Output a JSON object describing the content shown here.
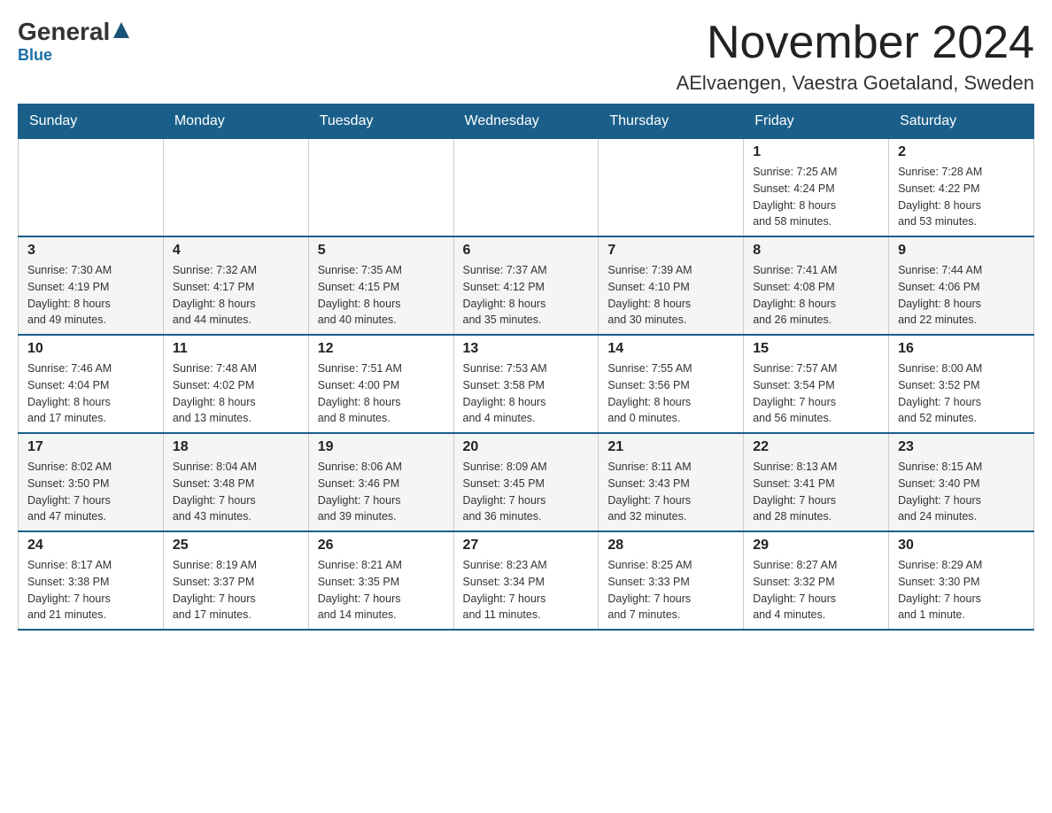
{
  "header": {
    "logo_general": "General",
    "logo_blue": "Blue",
    "month_title": "November 2024",
    "location": "AElvaengen, Vaestra Goetaland, Sweden"
  },
  "days_of_week": [
    "Sunday",
    "Monday",
    "Tuesday",
    "Wednesday",
    "Thursday",
    "Friday",
    "Saturday"
  ],
  "weeks": [
    {
      "days": [
        {
          "num": "",
          "info": ""
        },
        {
          "num": "",
          "info": ""
        },
        {
          "num": "",
          "info": ""
        },
        {
          "num": "",
          "info": ""
        },
        {
          "num": "",
          "info": ""
        },
        {
          "num": "1",
          "info": "Sunrise: 7:25 AM\nSunset: 4:24 PM\nDaylight: 8 hours\nand 58 minutes."
        },
        {
          "num": "2",
          "info": "Sunrise: 7:28 AM\nSunset: 4:22 PM\nDaylight: 8 hours\nand 53 minutes."
        }
      ]
    },
    {
      "days": [
        {
          "num": "3",
          "info": "Sunrise: 7:30 AM\nSunset: 4:19 PM\nDaylight: 8 hours\nand 49 minutes."
        },
        {
          "num": "4",
          "info": "Sunrise: 7:32 AM\nSunset: 4:17 PM\nDaylight: 8 hours\nand 44 minutes."
        },
        {
          "num": "5",
          "info": "Sunrise: 7:35 AM\nSunset: 4:15 PM\nDaylight: 8 hours\nand 40 minutes."
        },
        {
          "num": "6",
          "info": "Sunrise: 7:37 AM\nSunset: 4:12 PM\nDaylight: 8 hours\nand 35 minutes."
        },
        {
          "num": "7",
          "info": "Sunrise: 7:39 AM\nSunset: 4:10 PM\nDaylight: 8 hours\nand 30 minutes."
        },
        {
          "num": "8",
          "info": "Sunrise: 7:41 AM\nSunset: 4:08 PM\nDaylight: 8 hours\nand 26 minutes."
        },
        {
          "num": "9",
          "info": "Sunrise: 7:44 AM\nSunset: 4:06 PM\nDaylight: 8 hours\nand 22 minutes."
        }
      ]
    },
    {
      "days": [
        {
          "num": "10",
          "info": "Sunrise: 7:46 AM\nSunset: 4:04 PM\nDaylight: 8 hours\nand 17 minutes."
        },
        {
          "num": "11",
          "info": "Sunrise: 7:48 AM\nSunset: 4:02 PM\nDaylight: 8 hours\nand 13 minutes."
        },
        {
          "num": "12",
          "info": "Sunrise: 7:51 AM\nSunset: 4:00 PM\nDaylight: 8 hours\nand 8 minutes."
        },
        {
          "num": "13",
          "info": "Sunrise: 7:53 AM\nSunset: 3:58 PM\nDaylight: 8 hours\nand 4 minutes."
        },
        {
          "num": "14",
          "info": "Sunrise: 7:55 AM\nSunset: 3:56 PM\nDaylight: 8 hours\nand 0 minutes."
        },
        {
          "num": "15",
          "info": "Sunrise: 7:57 AM\nSunset: 3:54 PM\nDaylight: 7 hours\nand 56 minutes."
        },
        {
          "num": "16",
          "info": "Sunrise: 8:00 AM\nSunset: 3:52 PM\nDaylight: 7 hours\nand 52 minutes."
        }
      ]
    },
    {
      "days": [
        {
          "num": "17",
          "info": "Sunrise: 8:02 AM\nSunset: 3:50 PM\nDaylight: 7 hours\nand 47 minutes."
        },
        {
          "num": "18",
          "info": "Sunrise: 8:04 AM\nSunset: 3:48 PM\nDaylight: 7 hours\nand 43 minutes."
        },
        {
          "num": "19",
          "info": "Sunrise: 8:06 AM\nSunset: 3:46 PM\nDaylight: 7 hours\nand 39 minutes."
        },
        {
          "num": "20",
          "info": "Sunrise: 8:09 AM\nSunset: 3:45 PM\nDaylight: 7 hours\nand 36 minutes."
        },
        {
          "num": "21",
          "info": "Sunrise: 8:11 AM\nSunset: 3:43 PM\nDaylight: 7 hours\nand 32 minutes."
        },
        {
          "num": "22",
          "info": "Sunrise: 8:13 AM\nSunset: 3:41 PM\nDaylight: 7 hours\nand 28 minutes."
        },
        {
          "num": "23",
          "info": "Sunrise: 8:15 AM\nSunset: 3:40 PM\nDaylight: 7 hours\nand 24 minutes."
        }
      ]
    },
    {
      "days": [
        {
          "num": "24",
          "info": "Sunrise: 8:17 AM\nSunset: 3:38 PM\nDaylight: 7 hours\nand 21 minutes."
        },
        {
          "num": "25",
          "info": "Sunrise: 8:19 AM\nSunset: 3:37 PM\nDaylight: 7 hours\nand 17 minutes."
        },
        {
          "num": "26",
          "info": "Sunrise: 8:21 AM\nSunset: 3:35 PM\nDaylight: 7 hours\nand 14 minutes."
        },
        {
          "num": "27",
          "info": "Sunrise: 8:23 AM\nSunset: 3:34 PM\nDaylight: 7 hours\nand 11 minutes."
        },
        {
          "num": "28",
          "info": "Sunrise: 8:25 AM\nSunset: 3:33 PM\nDaylight: 7 hours\nand 7 minutes."
        },
        {
          "num": "29",
          "info": "Sunrise: 8:27 AM\nSunset: 3:32 PM\nDaylight: 7 hours\nand 4 minutes."
        },
        {
          "num": "30",
          "info": "Sunrise: 8:29 AM\nSunset: 3:30 PM\nDaylight: 7 hours\nand 1 minute."
        }
      ]
    }
  ]
}
